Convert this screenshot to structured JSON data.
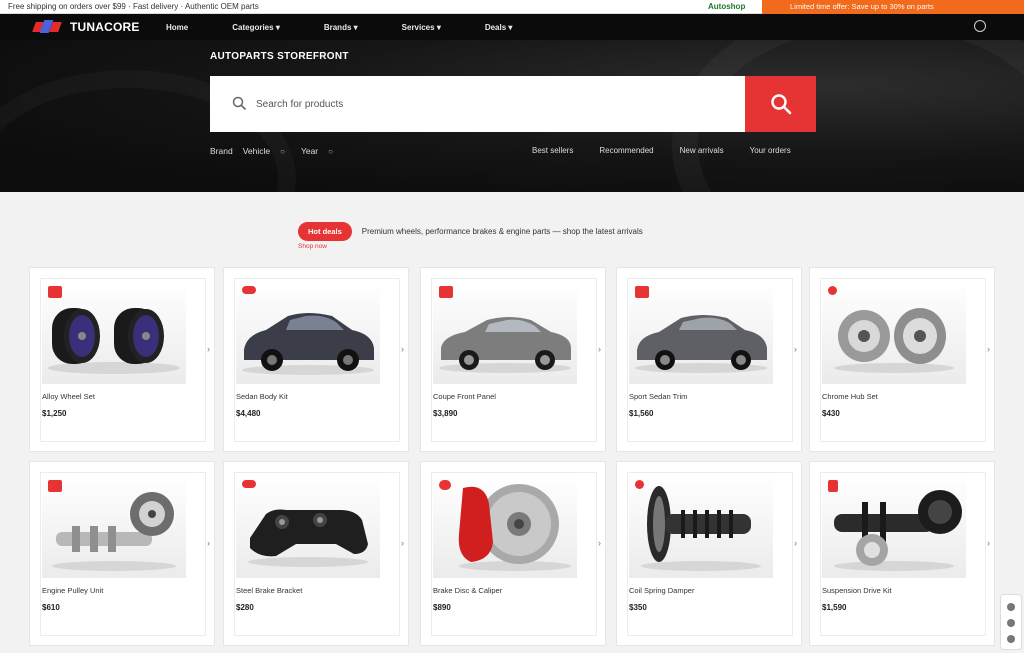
{
  "topbar": {
    "announcement": "Free shipping on orders over $99 · Fast delivery · Authentic OEM parts",
    "promo_green": "Autoshop",
    "promo_orange": "Limited time offer: Save up to 30% on parts"
  },
  "nav": {
    "brand": "TUNACORE",
    "links": [
      "Home",
      "Categories",
      "Brands",
      "Services",
      "Deals"
    ],
    "link_has_chevron": [
      false,
      true,
      true,
      true,
      true
    ]
  },
  "hero": {
    "title": "AUTOPARTS STOREFRONT",
    "search_placeholder": "Search for products",
    "filters": [
      {
        "label": "Brand",
        "chev": "▾"
      },
      {
        "label": "Vehicle",
        "chev": "○"
      },
      {
        "label": "Year",
        "chev": "○"
      }
    ],
    "links": [
      "Best sellers",
      "Recommended",
      "New arrivals",
      "Your orders"
    ]
  },
  "promo": {
    "pill": "Hot deals",
    "text": "Premium wheels, performance brakes & engine parts — shop the latest arrivals",
    "sub": "Shop now"
  },
  "products": [
    {
      "name": "Alloy Wheel Set",
      "price": "$1,250",
      "badge": "square"
    },
    {
      "name": "Sedan Body Kit",
      "price": "$4,480",
      "badge": "square"
    },
    {
      "name": "Coupe Front Panel",
      "price": "$3,890",
      "badge": "square"
    },
    {
      "name": "Sport Sedan Trim",
      "price": "$1,560",
      "badge": "square"
    },
    {
      "name": "Chrome Hub Set",
      "price": "$430",
      "badge": "round"
    },
    {
      "name": "Engine Pulley Unit",
      "price": "$610",
      "badge": "square"
    },
    {
      "name": "Steel Brake Bracket",
      "price": "$280",
      "badge": "round"
    },
    {
      "name": "Brake Disc & Caliper",
      "price": "$890",
      "badge": "square"
    },
    {
      "name": "Coil Spring Damper",
      "price": "$350",
      "badge": "round"
    },
    {
      "name": "Suspension Drive Kit",
      "price": "$1,590",
      "badge": "square"
    }
  ],
  "colors": {
    "accent": "#e63434",
    "nav_bg": "#0b0b0b",
    "orange": "#f26a1b"
  }
}
